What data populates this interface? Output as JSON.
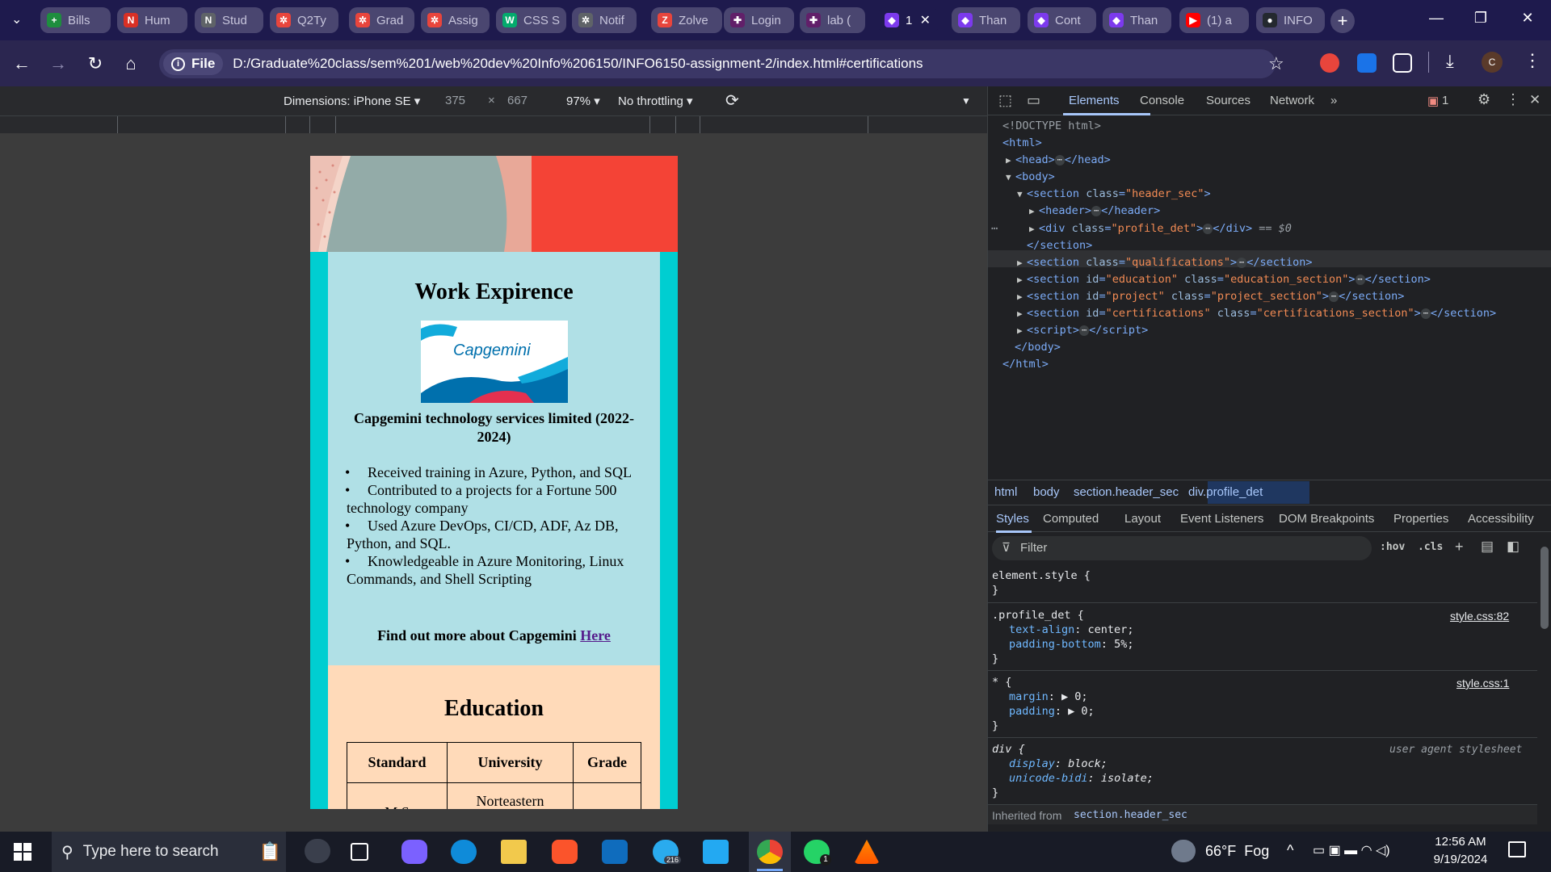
{
  "browser": {
    "tabs": [
      {
        "label": "Bills",
        "icon": "google-sheets-icon",
        "color": "#1e8e3e",
        "glyph": "+"
      },
      {
        "label": "Hum",
        "icon": "notion-icon",
        "color": "#d93025",
        "glyph": "N"
      },
      {
        "label": "Stud",
        "icon": "notion-icon",
        "color": "#5f6368",
        "glyph": "N"
      },
      {
        "label": "Q2Ty",
        "icon": "gear-red-icon",
        "color": "#e8453c",
        "glyph": "✲"
      },
      {
        "label": "Grad",
        "icon": "gear-red-icon",
        "color": "#e8453c",
        "glyph": "✲"
      },
      {
        "label": "Assig",
        "icon": "gear-red-icon",
        "color": "#e8453c",
        "glyph": "✲"
      },
      {
        "label": "CSS S",
        "icon": "w3schools-icon",
        "color": "#04aa6d",
        "glyph": "W"
      },
      {
        "label": "Notif",
        "icon": "gear-gray-icon",
        "color": "#5f6368",
        "glyph": "✲"
      },
      {
        "label": "Zolve",
        "icon": "zolve-icon",
        "color": "#e8453c",
        "glyph": "Z"
      },
      {
        "label": "Login",
        "icon": "slack-icon",
        "color": "#611f69",
        "glyph": "✚"
      },
      {
        "label": "lab (",
        "icon": "slack-icon",
        "color": "#611f69",
        "glyph": "✚"
      },
      {
        "label": "1",
        "icon": "app-icon",
        "color": "#7c3aed",
        "glyph": "◆",
        "active": true
      },
      {
        "label": "Than",
        "icon": "app-icon",
        "color": "#7c3aed",
        "glyph": "◆"
      },
      {
        "label": "Cont",
        "icon": "app-icon",
        "color": "#7c3aed",
        "glyph": "◆"
      },
      {
        "label": "Than",
        "icon": "app-icon",
        "color": "#7c3aed",
        "glyph": "◆"
      },
      {
        "label": "(1) a",
        "icon": "youtube-icon",
        "color": "#ff0000",
        "glyph": "▶"
      },
      {
        "label": "INFO",
        "icon": "github-icon",
        "color": "#24292f",
        "glyph": "●"
      }
    ],
    "address_scheme": "File",
    "address_url": "D:/Graduate%20class/sem%201/web%20dev%20Info%206150/INFO6150-assignment-2/index.html#certifications",
    "profile_initial": "C"
  },
  "device_toolbar": {
    "dimensions": "Dimensions: iPhone SE",
    "width": "375",
    "times": "×",
    "height": "667",
    "zoom": "97%",
    "throttling": "No throttling"
  },
  "page": {
    "work_heading": "Work Expirence",
    "logo_text": "Capgemini",
    "company": "Capgemini technology services limited (2022-2024)",
    "bullets": [
      "Received training in Azure, Python, and SQL",
      "Contributed to a projects for a Fortune 500 technology company",
      "Used Azure DevOps, CI/CD, ADF, Az DB, Python, and SQL.",
      "Knowledgeable in Azure Monitoring, Linux Commands, and Shell Scripting"
    ],
    "find_more": "Find out more about Capgemini",
    "find_more_link": "Here",
    "education_heading": "Education",
    "table_headers": [
      "Standard",
      "University",
      "Grade"
    ],
    "table_row1": [
      "M.S",
      "Norteastern",
      ""
    ]
  },
  "devtools": {
    "tabs": [
      "Elements",
      "Console",
      "Sources",
      "Network"
    ],
    "issues_count": "1",
    "dom": {
      "doctype": "<!DOCTYPE html>",
      "html_open": "<html>",
      "head": "head",
      "body": "body",
      "section_header": "section",
      "header": "header",
      "div_profile": "div",
      "selected_suffix": "== $0",
      "section_close": "</section>",
      "sec_qual_class": "qualifications",
      "sec_edu_id": "education",
      "sec_edu_class": "education_section",
      "sec_proj_id": "project",
      "sec_proj_class": "project_section",
      "sec_cert_id": "certifications",
      "sec_cert_class": "certifications_section",
      "script": "script",
      "body_close": "</body>",
      "html_close": "</html>"
    },
    "breadcrumbs": [
      "html",
      "body",
      "section.header_sec",
      "div.profile_det"
    ],
    "subtabs": [
      "Styles",
      "Computed",
      "Layout",
      "Event Listeners",
      "DOM Breakpoints",
      "Properties",
      "Accessibility"
    ],
    "filter_placeholder": "Filter",
    "hov": ":hov",
    "cls": ".cls",
    "styles": {
      "element_style": "element.style {",
      "close_brace": "}",
      "profile_sel": ".profile_det {",
      "profile_src": "style.css:82",
      "profile_p1_name": "text-align",
      "profile_p1_val": "center;",
      "profile_p2_name": "padding-bottom",
      "profile_p2_val": "5%;",
      "star_sel": "* {",
      "star_src": "style.css:1",
      "star_p1_name": "margin",
      "star_p1_val": "0;",
      "star_p2_name": "padding",
      "star_p2_val": "0;",
      "div_sel": "div {",
      "div_src": "user agent stylesheet",
      "div_p1_name": "display",
      "div_p1_val": "block;",
      "div_p2_name": "unicode-bidi",
      "div_p2_val": "isolate;",
      "inherited_label": "Inherited from",
      "inherited_from": "section.header_sec"
    }
  },
  "taskbar": {
    "search_placeholder": "Type here to search",
    "weather": "66°F  Fog",
    "time": "12:56 AM",
    "date": "9/19/2024",
    "telegram_badge": "216",
    "whatsapp_badge": "1"
  }
}
